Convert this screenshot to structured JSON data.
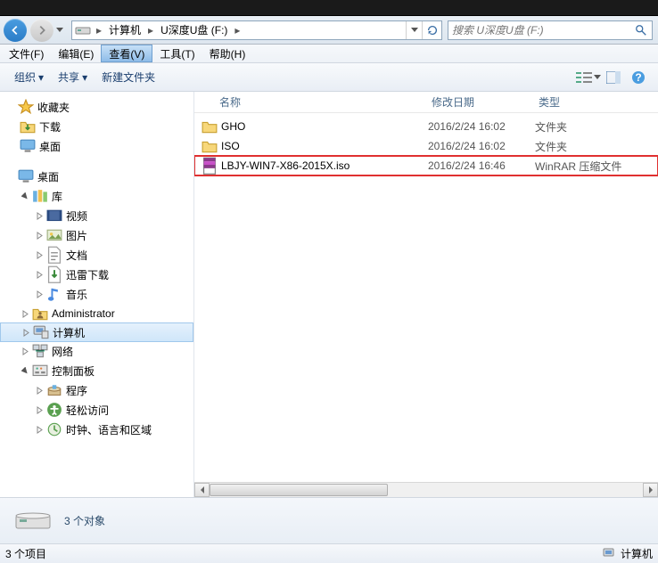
{
  "breadcrumb": {
    "items": [
      "计算机",
      "U深度U盘 (F:)"
    ]
  },
  "search": {
    "placeholder": "搜索 U深度U盘 (F:)"
  },
  "menu": {
    "file": "文件(F)",
    "edit": "编辑(E)",
    "view": "查看(V)",
    "tools": "工具(T)",
    "help": "帮助(H)"
  },
  "toolbar": {
    "organize": "组织",
    "share": "共享",
    "new_folder": "新建文件夹"
  },
  "columns": {
    "name": "名称",
    "date": "修改日期",
    "type": "类型"
  },
  "files": [
    {
      "icon": "folder",
      "name": "GHO",
      "date": "2016/2/24 16:02",
      "type": "文件夹",
      "highlighted": false
    },
    {
      "icon": "folder",
      "name": "ISO",
      "date": "2016/2/24 16:02",
      "type": "文件夹",
      "highlighted": false
    },
    {
      "icon": "rar",
      "name": "LBJY-WIN7-X86-2015X.iso",
      "date": "2016/2/24 16:46",
      "type": "WinRAR 压缩文件",
      "highlighted": true
    }
  ],
  "sidebar": {
    "favorites": {
      "label": "收藏夹",
      "children": [
        {
          "label": "下载",
          "icon": "download-folder"
        },
        {
          "label": "桌面",
          "icon": "desktop"
        }
      ]
    },
    "desktop": {
      "label": "桌面",
      "children": [
        {
          "label": "库",
          "icon": "library",
          "expanded": true,
          "children": [
            {
              "label": "视频",
              "icon": "video"
            },
            {
              "label": "图片",
              "icon": "picture"
            },
            {
              "label": "文档",
              "icon": "document"
            },
            {
              "label": "迅雷下载",
              "icon": "xunlei"
            },
            {
              "label": "音乐",
              "icon": "music"
            }
          ]
        },
        {
          "label": "Administrator",
          "icon": "user"
        },
        {
          "label": "计算机",
          "icon": "computer",
          "selected": true
        },
        {
          "label": "网络",
          "icon": "network"
        },
        {
          "label": "控制面板",
          "icon": "control-panel",
          "expanded": true,
          "children": [
            {
              "label": "程序",
              "icon": "programs"
            },
            {
              "label": "轻松访问",
              "icon": "ease"
            },
            {
              "label": "时钟、语言和区域",
              "icon": "clock"
            }
          ]
        }
      ]
    }
  },
  "details": {
    "count_label": "3 个对象"
  },
  "status": {
    "left": "3 个项目",
    "right": "计算机"
  }
}
